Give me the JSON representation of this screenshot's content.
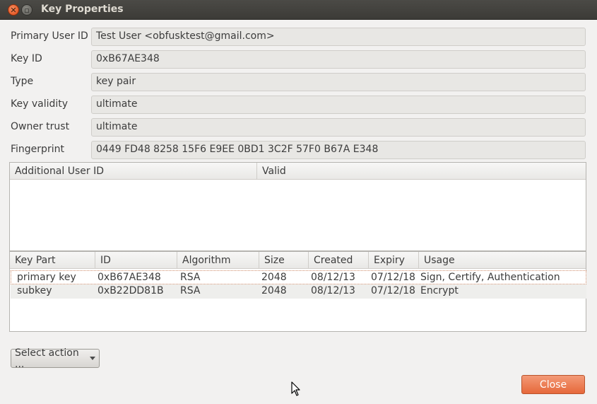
{
  "window": {
    "title": "Key Properties"
  },
  "properties": [
    {
      "label": "Primary User ID",
      "value": "Test User <obfusktest@gmail.com>"
    },
    {
      "label": "Key ID",
      "value": "0xB67AE348"
    },
    {
      "label": "Type",
      "value": "key pair"
    },
    {
      "label": "Key validity",
      "value": "ultimate"
    },
    {
      "label": "Owner trust",
      "value": "ultimate"
    },
    {
      "label": "Fingerprint",
      "value": "0449 FD48 8258 15F6 E9EE 0BD1 3C2F 57F0 B67A E348"
    }
  ],
  "user_ids_table": {
    "headers": [
      "Additional User ID",
      "Valid"
    ],
    "rows": []
  },
  "key_parts_table": {
    "headers": [
      "Key Part",
      "ID",
      "Algorithm",
      "Size",
      "Created",
      "Expiry",
      "Usage"
    ],
    "rows": [
      [
        "primary key",
        "0xB67AE348",
        "RSA",
        "2048",
        "08/12/13",
        "07/12/18",
        "Sign, Certify, Authentication"
      ],
      [
        "subkey",
        "0xB22DD81B",
        "RSA",
        "2048",
        "08/12/13",
        "07/12/18",
        "Encrypt"
      ]
    ]
  },
  "actions": {
    "select_action_label": "Select action ...",
    "close_label": "Close"
  },
  "colors": {
    "accent": "#e6683a",
    "titlebar": "#3c3b37"
  }
}
